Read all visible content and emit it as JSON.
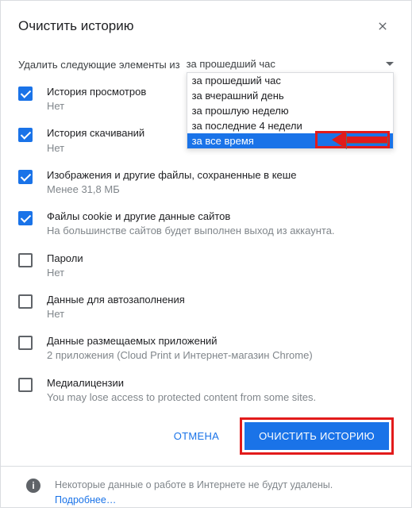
{
  "dialog": {
    "title": "Очистить историю"
  },
  "timeRange": {
    "label": "Удалить следующие элементы из",
    "selected": "за прошедший час",
    "options": [
      "за прошедший час",
      "за вчерашний день",
      "за прошлую неделю",
      "за последние 4 недели",
      "за все время"
    ],
    "highlightedIndex": 4
  },
  "items": [
    {
      "title": "История просмотров",
      "sub": "Нет",
      "checked": true
    },
    {
      "title": "История скачиваний",
      "sub": "Нет",
      "checked": true
    },
    {
      "title": "Изображения и другие файлы, сохраненные в кеше",
      "sub": "Менее 31,8 МБ",
      "checked": true
    },
    {
      "title": "Файлы cookie и другие данные сайтов",
      "sub": "На большинстве сайтов будет выполнен выход из аккаунта.",
      "checked": true
    },
    {
      "title": "Пароли",
      "sub": "Нет",
      "checked": false
    },
    {
      "title": "Данные для автозаполнения",
      "sub": "Нет",
      "checked": false
    },
    {
      "title": "Данные размещаемых приложений",
      "sub": "2 приложения (Cloud Print и Интернет-магазин Chrome)",
      "checked": false
    },
    {
      "title": "Медиалицензии",
      "sub": "You may lose access to protected content from some sites.",
      "checked": false
    }
  ],
  "buttons": {
    "cancel": "ОТМЕНА",
    "confirm": "ОЧИСТИТЬ ИСТОРИЮ"
  },
  "footer": {
    "text": "Некоторые данные о работе в Интернете не будут удалены.",
    "link": "Подробнее…"
  },
  "annotation": {
    "highlightConfirm": true,
    "arrowColor": "#e21b1b"
  }
}
